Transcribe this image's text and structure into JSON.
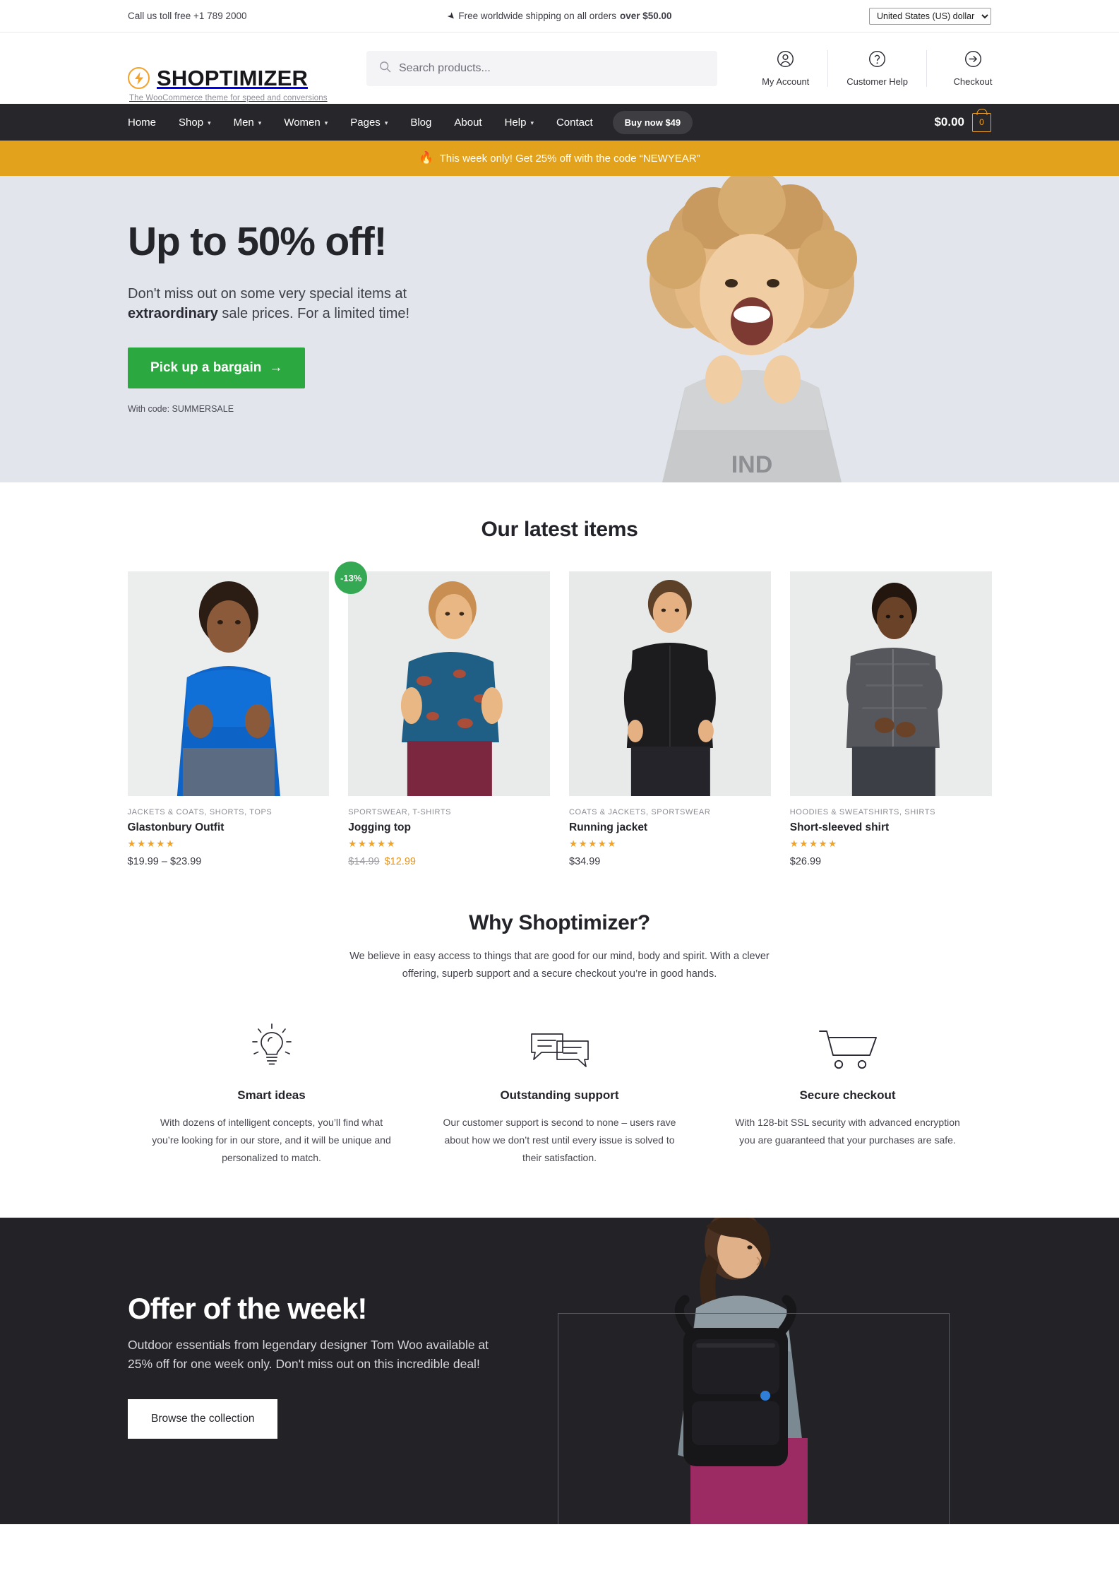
{
  "topbar": {
    "phone": "Call us toll free +1 789 2000",
    "shipping_prefix": "Free worldwide shipping on all orders ",
    "shipping_strong": "over $50.00",
    "plane_icon": "paper-plane-icon",
    "currency_selected": "United States (US) dollar",
    "currency_options": [
      "United States (US) dollar"
    ]
  },
  "header": {
    "brand_name": "SHOPTIMIZER",
    "brand_tagline": "The WooCommerce theme for speed and conversions",
    "logo_icon": "lightning-bolt-icon",
    "search_placeholder": "Search products...",
    "search_value": "",
    "search_icon": "search-icon",
    "actions": [
      {
        "label": "My Account",
        "icon": "user-circle-icon"
      },
      {
        "label": "Customer Help",
        "icon": "question-circle-icon"
      },
      {
        "label": "Checkout",
        "icon": "arrow-right-circle-icon"
      }
    ]
  },
  "nav": {
    "items": [
      {
        "label": "Home",
        "has_dropdown": false
      },
      {
        "label": "Shop",
        "has_dropdown": true
      },
      {
        "label": "Men",
        "has_dropdown": true
      },
      {
        "label": "Women",
        "has_dropdown": true
      },
      {
        "label": "Pages",
        "has_dropdown": true
      },
      {
        "label": "Blog",
        "has_dropdown": false
      },
      {
        "label": "About",
        "has_dropdown": false
      },
      {
        "label": "Help",
        "has_dropdown": true
      },
      {
        "label": "Contact",
        "has_dropdown": false
      }
    ],
    "cta_label": "Buy now $49",
    "cart_total": "$0.00",
    "cart_count": "0",
    "cart_icon": "shopping-bag-icon",
    "caret_glyph": "⌄"
  },
  "promo": {
    "fire_icon": "🔥",
    "text": "This week only! Get 25% off with the code “NEWYEAR”"
  },
  "hero": {
    "title": "Up to 50% off!",
    "sub_part1": "Don't miss out on some very special items at ",
    "sub_strong": "extraordinary",
    "sub_part2": " sale prices. For a limited time!",
    "button_label": "Pick up a bargain",
    "button_arrow": "→",
    "code_note": "With code: SUMMERSALE",
    "background_color": "#E2E5EC",
    "button_color": "#2BA83F"
  },
  "products": {
    "heading": "Our latest items",
    "items": [
      {
        "categories": "JACKETS & COATS, SHORTS, TOPS",
        "name": "Glastonbury Outfit",
        "rating": "★★★★★",
        "price": "$19.99 – $23.99",
        "price_old": "",
        "price_new": "",
        "badge": ""
      },
      {
        "categories": "SPORTSWEAR, T-SHIRTS",
        "name": "Jogging top",
        "rating": "★★★★★",
        "price": "",
        "price_old": "$14.99",
        "price_new": "$12.99",
        "badge": "-13%"
      },
      {
        "categories": "COATS & JACKETS, SPORTSWEAR",
        "name": "Running jacket",
        "rating": "★★★★★",
        "price": "$34.99",
        "price_old": "",
        "price_new": "",
        "badge": ""
      },
      {
        "categories": "HOODIES & SWEATSHIRTS, SHIRTS",
        "name": "Short-sleeved shirt",
        "rating": "★★★★★",
        "price": "$26.99",
        "price_old": "",
        "price_new": "",
        "badge": ""
      }
    ]
  },
  "why": {
    "heading": "Why Shoptimizer?",
    "intro": "We believe in easy access to things that are good for our mind, body and spirit. With a clever offering, superb support and a secure checkout you’re in good hands.",
    "columns": [
      {
        "icon": "lightbulb-icon",
        "title": "Smart ideas",
        "text": "With dozens of intelligent concepts, you’ll find what you’re looking for in our store, and it will be unique and personalized to match."
      },
      {
        "icon": "speech-bubbles-icon",
        "title": "Outstanding support",
        "text": "Our customer support is second to none – users rave about how we don’t rest until every issue is solved to their satisfaction."
      },
      {
        "icon": "shopping-cart-icon",
        "title": "Secure checkout",
        "text": "With 128-bit SSL security with advanced encryption you are guaranteed that your purchases are safe."
      }
    ]
  },
  "offer": {
    "title": "Offer of the week!",
    "text": "Outdoor essentials from legendary designer Tom Woo available at 25% off for one week only. Don't miss out on this incredible deal!",
    "button_label": "Browse the collection",
    "background_color": "#232327"
  }
}
